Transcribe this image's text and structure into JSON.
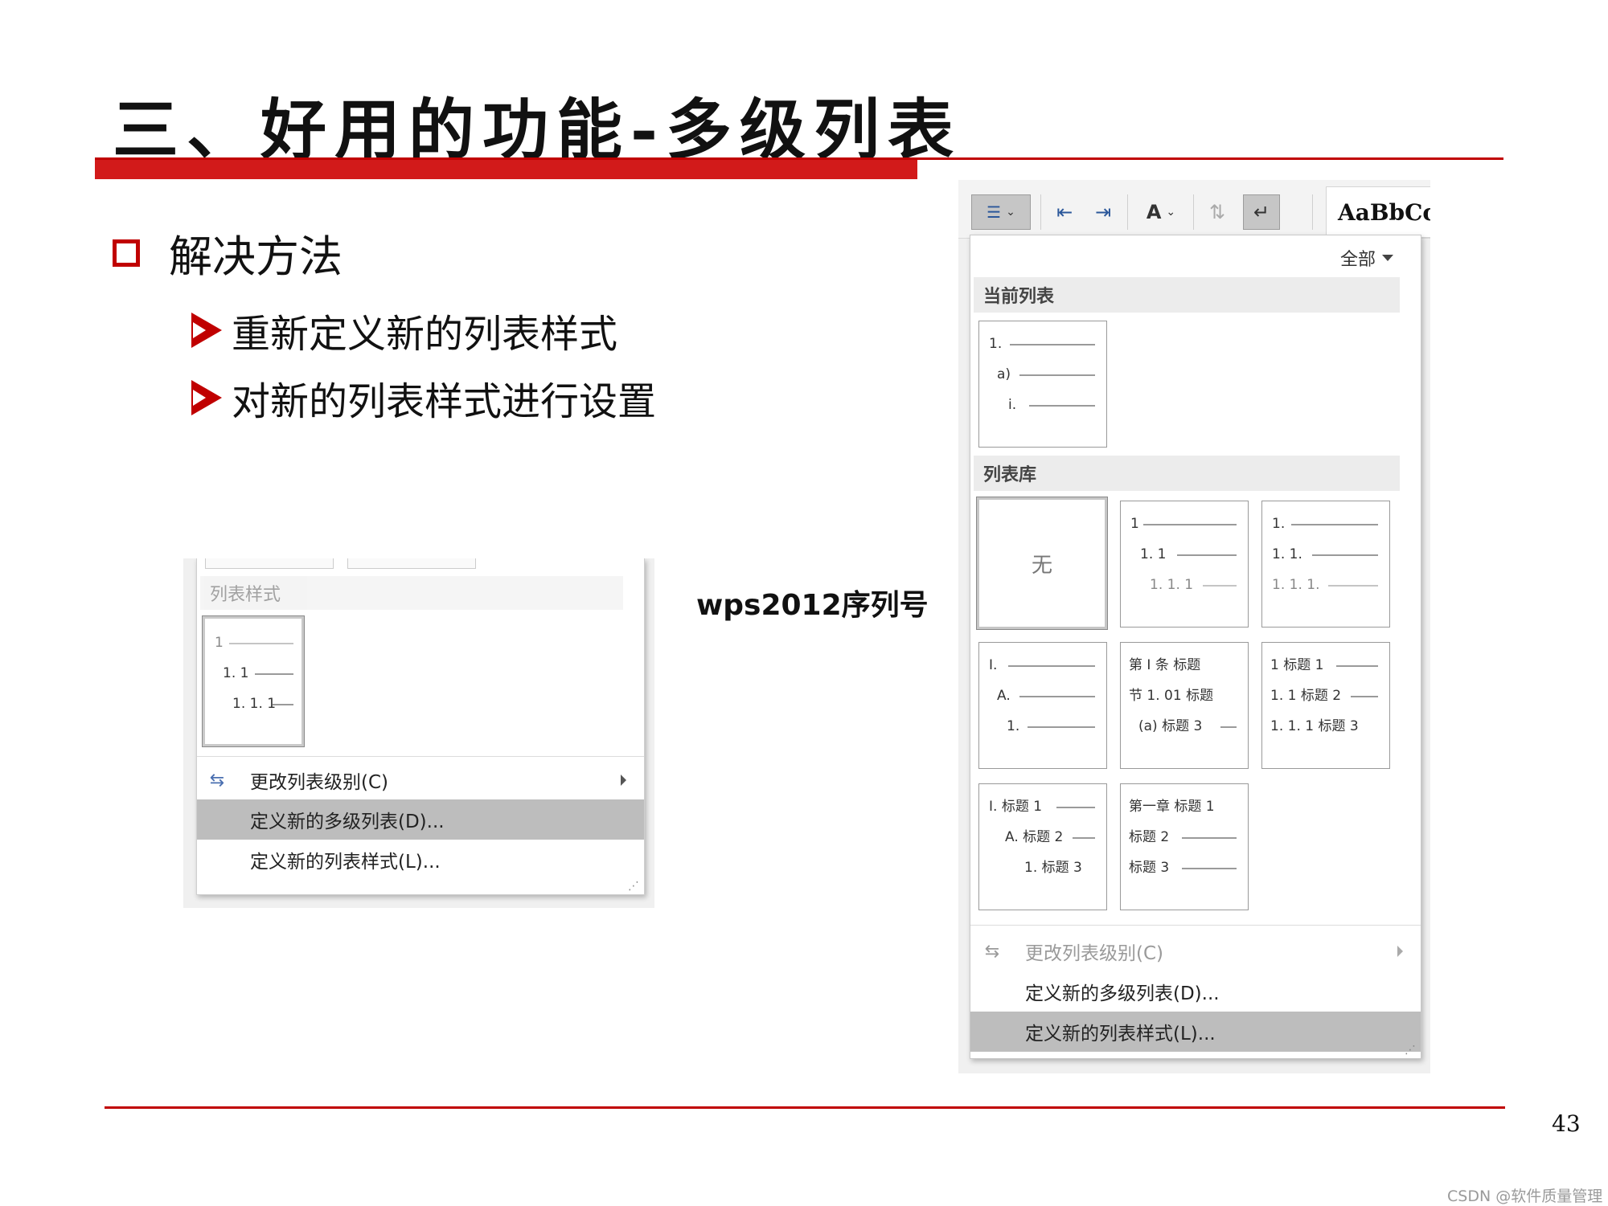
{
  "slide": {
    "title": "三、好用的功能-多级列表",
    "bullet": "解决方法",
    "sub_bullets": [
      "重新定义新的列表样式",
      "对新的列表样式进行设置"
    ],
    "screenshot_label": "wps2012序列号",
    "page_number": "43",
    "watermark": "CSDN @软件质量管理"
  },
  "left_menu": {
    "section": "列表样式",
    "thumb": [
      "1",
      "1. 1",
      "1. 1. 1"
    ],
    "items": [
      {
        "label": "更改列表级别(C)",
        "icon": "change-level-icon",
        "submenu": true,
        "highlighted": false
      },
      {
        "label": "定义新的多级列表(D)...",
        "highlighted": true
      },
      {
        "label": "定义新的列表样式(L)...",
        "highlighted": false
      }
    ]
  },
  "right_menu": {
    "toolbar": {
      "style_preview": "AaBbCc"
    },
    "filter_label": "全部",
    "current_section": "当前列表",
    "current_thumb": [
      "1.",
      "a)",
      "i."
    ],
    "library_section": "列表库",
    "none_label": "无",
    "library": [
      [
        "1",
        "1. 1",
        "1. 1. 1"
      ],
      [
        "1.",
        "1. 1.",
        "1. 1. 1."
      ],
      [
        "I.",
        "A.",
        "1."
      ],
      [
        "第 I 条 标题",
        "节 1. 01 标题",
        "(a) 标题 3"
      ],
      [
        "1 标题 1",
        "1. 1 标题 2",
        "1. 1. 1 标题 3"
      ],
      [
        "I. 标题 1",
        "A. 标题 2",
        "1. 标题 3"
      ],
      [
        "第一章 标题 1",
        "标题 2",
        "标题 3"
      ]
    ],
    "items": [
      {
        "label": "更改列表级别(C)",
        "icon": "change-level-icon",
        "submenu": true,
        "disabled": true
      },
      {
        "label": "定义新的多级列表(D)...",
        "highlighted": false
      },
      {
        "label": "定义新的列表样式(L)...",
        "highlighted": true
      }
    ]
  },
  "colors": {
    "accent_red": "#c00000",
    "highlight_gray": "#bdbdbd"
  }
}
